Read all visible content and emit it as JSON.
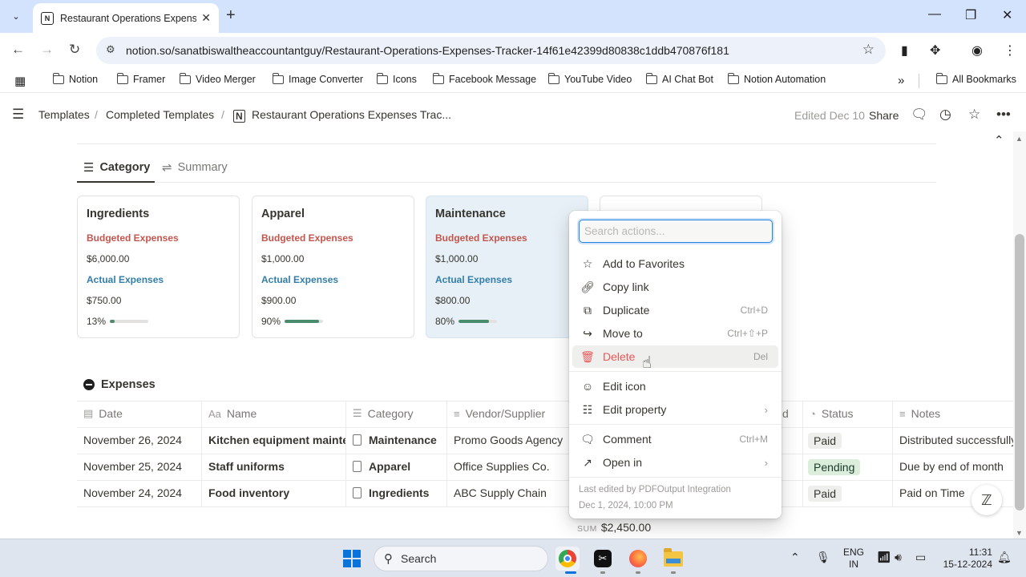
{
  "browser": {
    "tab_title": "Restaurant Operations Expenses",
    "tab_favicon": "N",
    "url": "notion.so/sanatbiswaltheaccountantguy/Restaurant-Operations-Expenses-Tracker-14f61e42399d80838c1ddb470876f181",
    "bookmarks": [
      "Notion",
      "Framer",
      "Video Merger",
      "Image Converter",
      "Icons",
      "Facebook Message",
      "YouTube Video",
      "AI Chat Bot",
      "Notion Automation"
    ],
    "all_bookmarks": "All Bookmarks"
  },
  "notion": {
    "breadcrumbs": [
      "Templates",
      "/",
      "Completed Templates",
      "/",
      "Restaurant Operations Expenses Trac..."
    ],
    "edited": "Edited Dec 10",
    "share": "Share",
    "views": [
      "Category",
      "Summary"
    ],
    "cards": [
      {
        "title": "Ingredients",
        "budget_label": "Budgeted Expenses",
        "budget": "$6,000.00",
        "actual_label": "Actual Expenses",
        "actual": "$750.00",
        "pct_label": "13%",
        "progress": 0.13
      },
      {
        "title": "Apparel",
        "budget_label": "Budgeted Expenses",
        "budget": "$1,000.00",
        "actual_label": "Actual Expenses",
        "actual": "$900.00",
        "pct_label": "90%",
        "progress": 0.9
      },
      {
        "title": "Maintenance",
        "budget_label": "Budgeted Expenses",
        "budget": "$1,000.00",
        "actual_label": "Actual Expenses",
        "actual": "$800.00",
        "pct_label": "80%",
        "progress": 0.8
      }
    ],
    "expenses": {
      "title": "Expenses",
      "columns": [
        "Date",
        "Name",
        "Category",
        "Vendor/Supplier",
        "d",
        "Status",
        "Notes"
      ],
      "rows": [
        {
          "date": "November 26, 2024",
          "name": "Kitchen equipment maintenance",
          "category": "Maintenance",
          "vendor": "Promo Goods Agency",
          "status": "Paid",
          "notes": "Distributed successfully"
        },
        {
          "date": "November 25, 2024",
          "name": "Staff uniforms",
          "category": "Apparel",
          "vendor": "Office Supplies Co.",
          "status": "Pending",
          "notes": "Due by end of month"
        },
        {
          "date": "November 24, 2024",
          "name": "Food inventory",
          "category": "Ingredients",
          "vendor": "ABC Supply Chain",
          "status": "Paid",
          "notes": "Paid on Time"
        }
      ],
      "sum_label": "SUM",
      "sum_value": "$2,450.00"
    }
  },
  "menu": {
    "search_placeholder": "Search actions...",
    "items": [
      {
        "label": "Add to Favorites",
        "shortcut": ""
      },
      {
        "label": "Copy link",
        "shortcut": ""
      },
      {
        "label": "Duplicate",
        "shortcut": "Ctrl+D"
      },
      {
        "label": "Move to",
        "shortcut": "Ctrl+⇧+P"
      },
      {
        "label": "Delete",
        "shortcut": "Del"
      },
      {
        "label": "Edit icon",
        "shortcut": ""
      },
      {
        "label": "Edit property",
        "shortcut": ""
      },
      {
        "label": "Comment",
        "shortcut": "Ctrl+M"
      },
      {
        "label": "Open in",
        "shortcut": ""
      }
    ],
    "footer_line1": "Last edited by PDFOutput Integration",
    "footer_line2": "Dec 1, 2024, 10:00 PM"
  },
  "taskbar": {
    "search": "Search",
    "lang_line1": "ENG",
    "lang_line2": "IN",
    "time": "11:31",
    "date": "15-12-2024"
  },
  "colors": {
    "budget_label": "#c4554d",
    "actual_label": "#337ea9",
    "progress_fill": "#4a8b6b",
    "delete_red": "#eb5757",
    "highlight_card": "#e7f0f6"
  }
}
